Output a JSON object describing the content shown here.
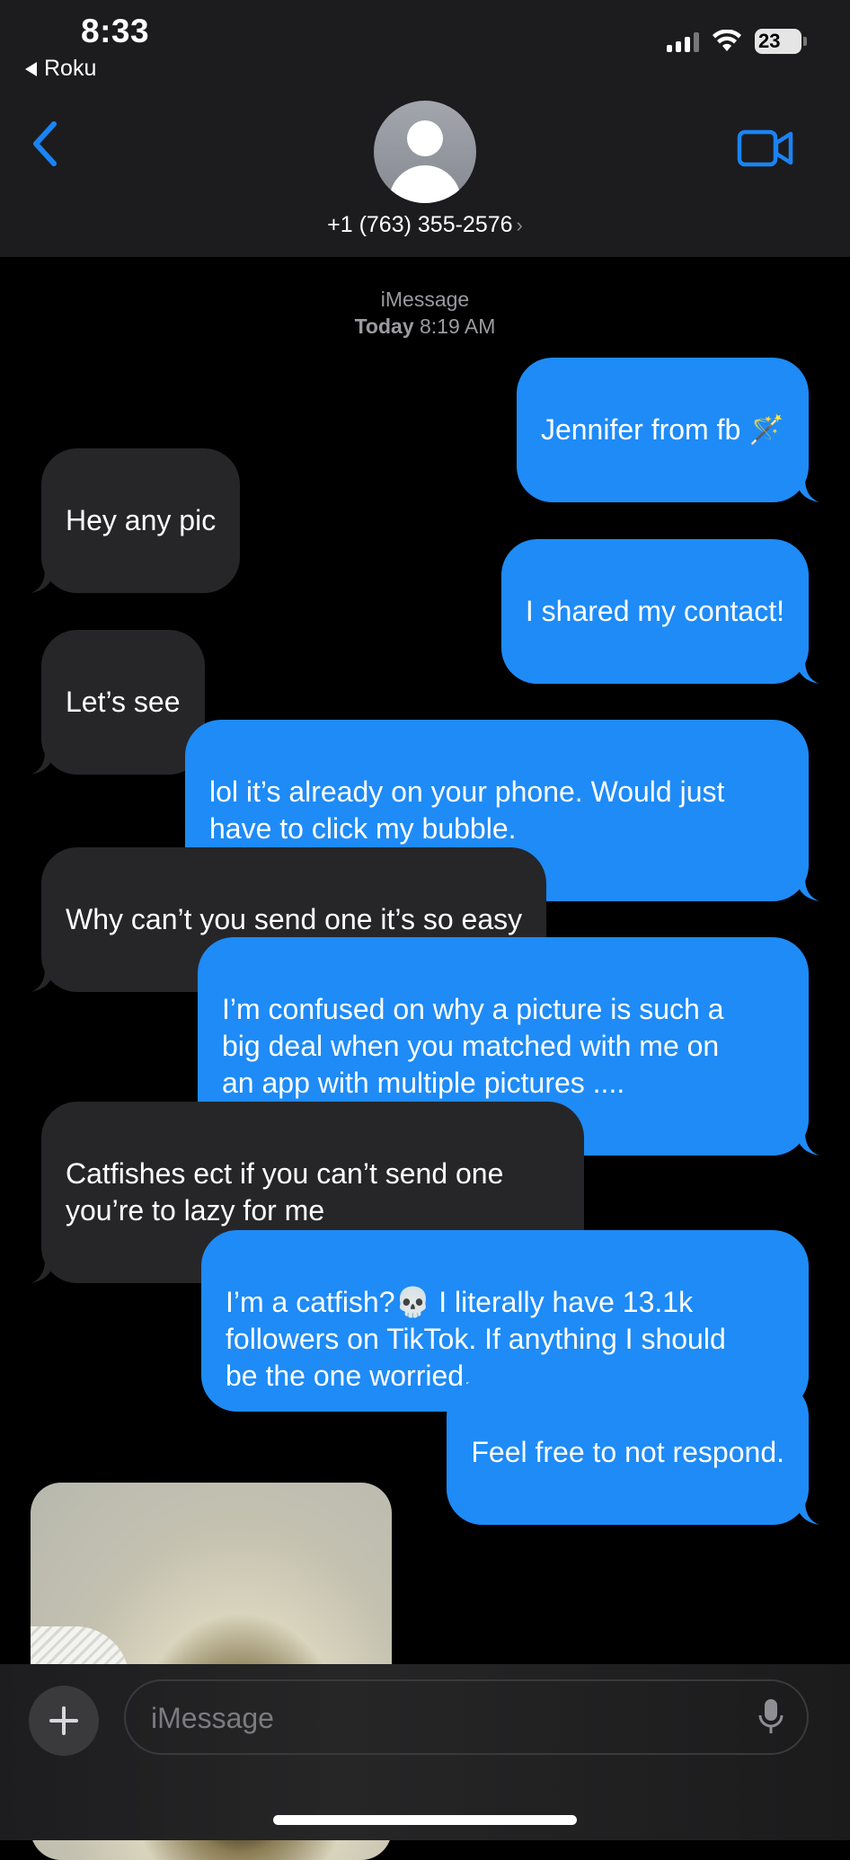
{
  "status_bar": {
    "time": "8:33",
    "back_app": "Roku",
    "battery": "23"
  },
  "header": {
    "contact": "+1 (763) 355-2576",
    "chevron": "›"
  },
  "conversation": {
    "service": "iMessage",
    "day": "Today",
    "time": "8:19 AM",
    "messages": [
      {
        "dir": "sent",
        "text": "Jennifer from fb 🪄"
      },
      {
        "dir": "received",
        "text": "Hey any pic"
      },
      {
        "dir": "sent",
        "text": "I shared my contact!"
      },
      {
        "dir": "received",
        "text": "Let’s see"
      },
      {
        "dir": "sent",
        "text": "lol it’s already on your phone. Would just\nhave to click my bubble."
      },
      {
        "dir": "received",
        "text": "Why can’t you send one it’s so easy"
      },
      {
        "dir": "sent",
        "text": "I’m confused on why a picture is such a\nbig deal when you matched with me on\nan app with multiple pictures ...."
      },
      {
        "dir": "received",
        "text": "Catfishes ect if you can’t send one\nyou’re to lazy for me"
      },
      {
        "dir": "sent",
        "text": "I’m a catfish?💀 I literally have 13.1k\nfollowers on TikTok. If anything I should\nbe the one worried."
      },
      {
        "dir": "sent",
        "text": "Feel free to not respond."
      }
    ]
  },
  "composer": {
    "placeholder": "iMessage"
  },
  "colors": {
    "sent_bubble": "#1e8bf7",
    "received_bubble": "#262629",
    "accent": "#1a84f4"
  }
}
